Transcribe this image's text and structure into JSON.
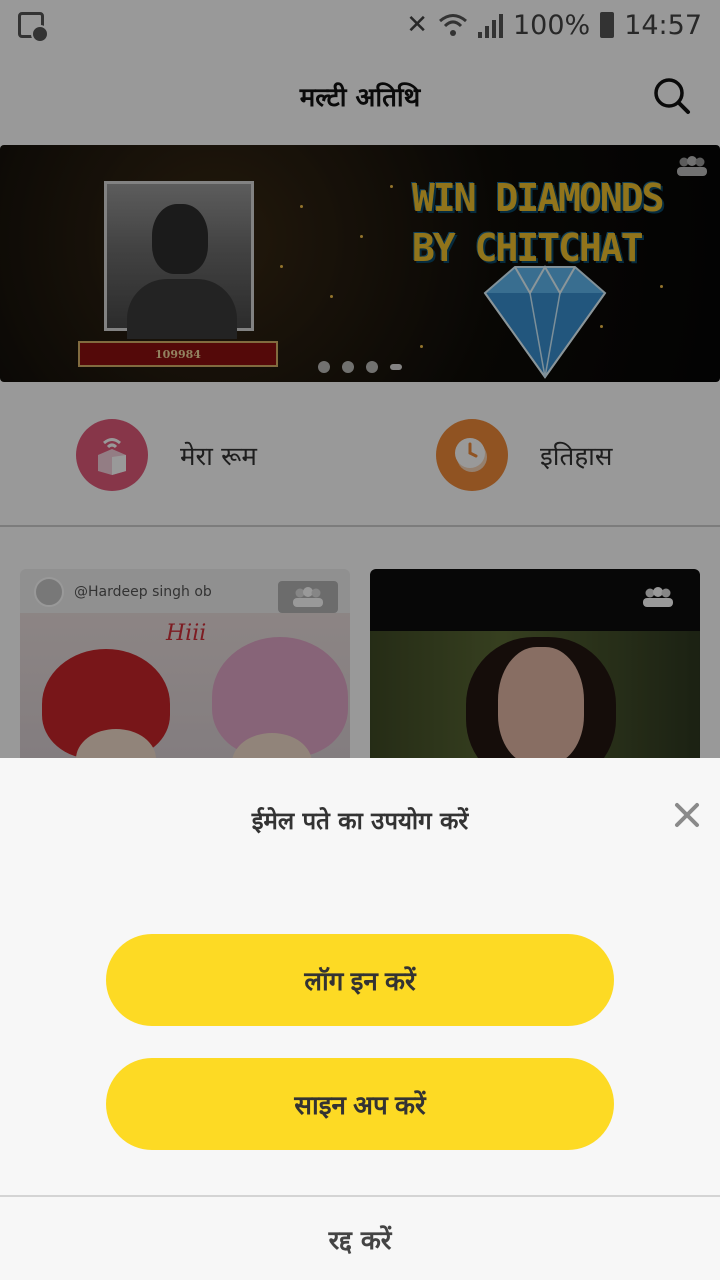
{
  "status_bar": {
    "battery_percent": "100%",
    "time": "14:57",
    "icons": [
      "screen-record-icon",
      "mute-icon",
      "wifi-icon",
      "signal-icon",
      "battery-icon"
    ]
  },
  "header": {
    "title": "मल्टी अतिथि",
    "search_icon": "search-icon"
  },
  "banner": {
    "headline_line1": "WIN DIAMONDS",
    "headline_line2": "BY CHITCHAT",
    "ribbon_id": "109984",
    "slide_count": 4,
    "active_slide": 4
  },
  "quick_actions": [
    {
      "label": "मेरा रूम",
      "icon": "room-icon",
      "color": "#e15a7b"
    },
    {
      "label": "इतिहास",
      "icon": "clock-icon",
      "color": "#f08a3a"
    }
  ],
  "rooms": [
    {
      "user": "@Hardeep singh ob",
      "caption": "Hiii"
    },
    {
      "user": "",
      "caption": ""
    }
  ],
  "sheet": {
    "title": "ईमेल पते का उपयोग करें",
    "login_label": "लॉग इन करें",
    "signup_label": "साइन अप करें",
    "cancel_label": "रद्द करें",
    "button_color": "#fdda24"
  }
}
